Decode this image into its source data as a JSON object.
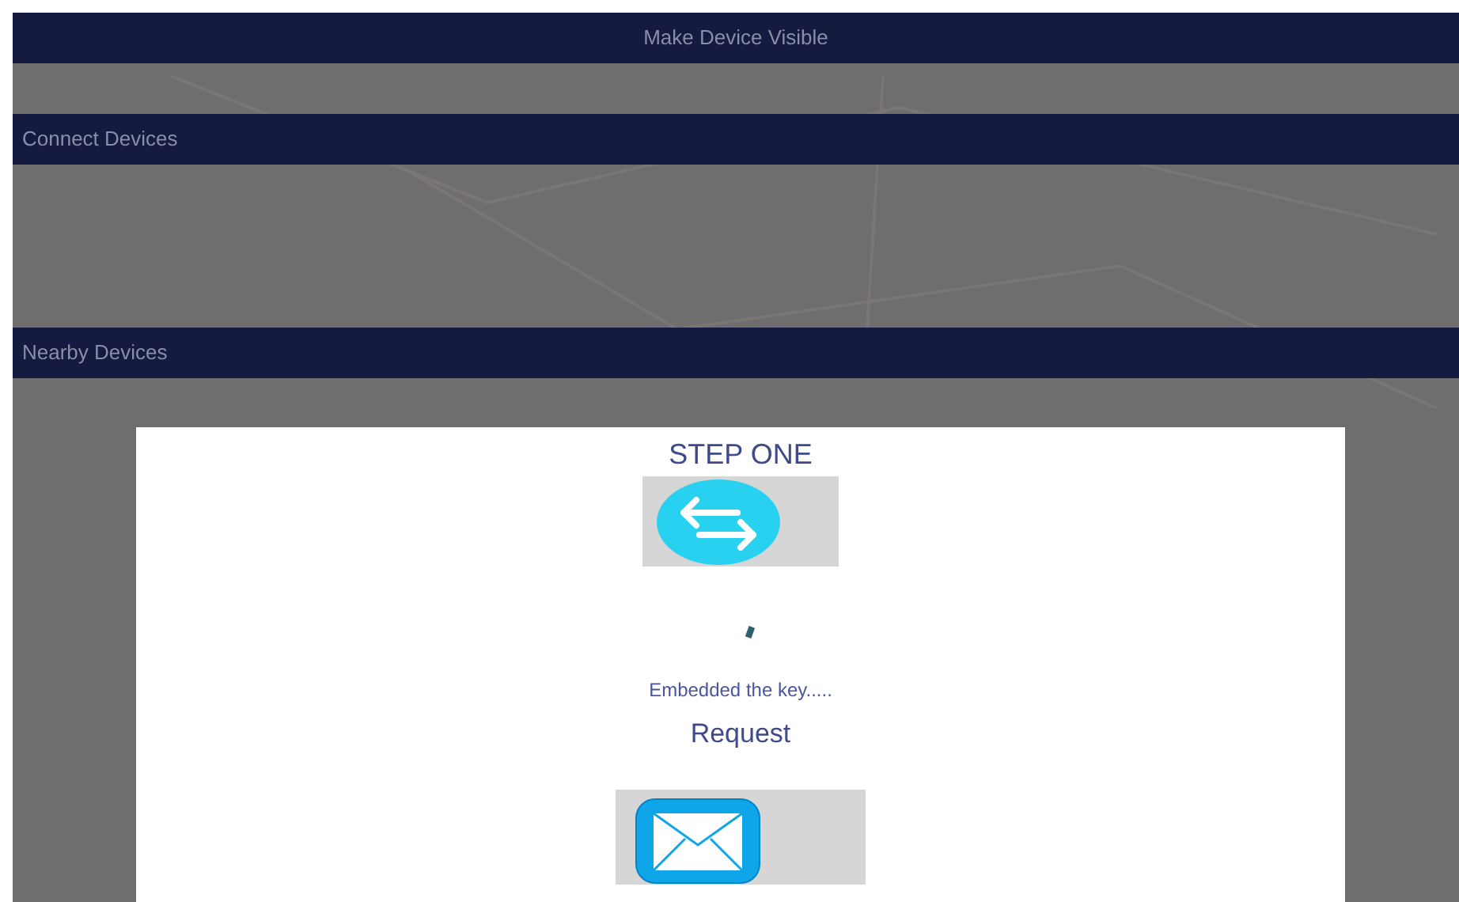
{
  "sections": [
    {
      "title": "Make Device Visible"
    },
    {
      "title": "Connect Devices"
    },
    {
      "title": "Nearby Devices"
    }
  ],
  "dialog": {
    "heading": "STEP ONE",
    "status": "Embedded the key.....",
    "action": "Request"
  }
}
